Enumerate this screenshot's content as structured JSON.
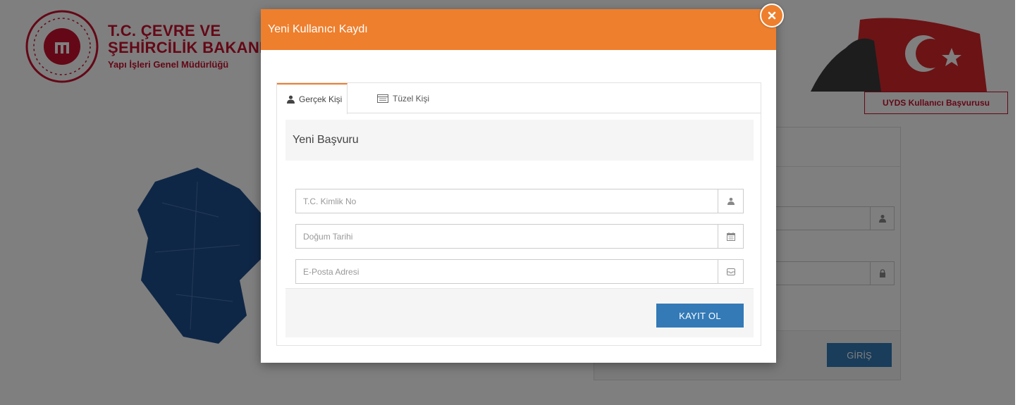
{
  "header": {
    "org_line1": "T.C. ÇEVRE VE",
    "org_line2": "ŞEHİRCİLİK BAKANLIĞI",
    "org_line3": "Yapı İşleri Genel Müdürlüğü"
  },
  "apply_link": {
    "label": "UYDS Kullanıcı Başvurusu"
  },
  "login": {
    "submit_label": "GİRİŞ"
  },
  "modal": {
    "title": "Yeni Kullanıcı Kaydı",
    "close_icon": "times-icon",
    "tabs": [
      {
        "label": "Gerçek Kişi",
        "icon": "user-icon",
        "active": true
      },
      {
        "label": "Tüzel Kişi",
        "icon": "building-icon",
        "active": false
      }
    ],
    "section_title": "Yeni Başvuru",
    "fields": [
      {
        "placeholder": "T.C. Kimlik No",
        "icon": "user-icon"
      },
      {
        "placeholder": "Doğum Tarihi",
        "icon": "calendar-icon"
      },
      {
        "placeholder": "E-Posta Adresi",
        "icon": "envelope-icon"
      }
    ],
    "submit_label": "KAYIT OL"
  },
  "colors": {
    "accent": "#ee7f2d",
    "brand_red": "#c8102e",
    "primary_button": "#337ab7",
    "map_blue": "#1f4e8c"
  }
}
